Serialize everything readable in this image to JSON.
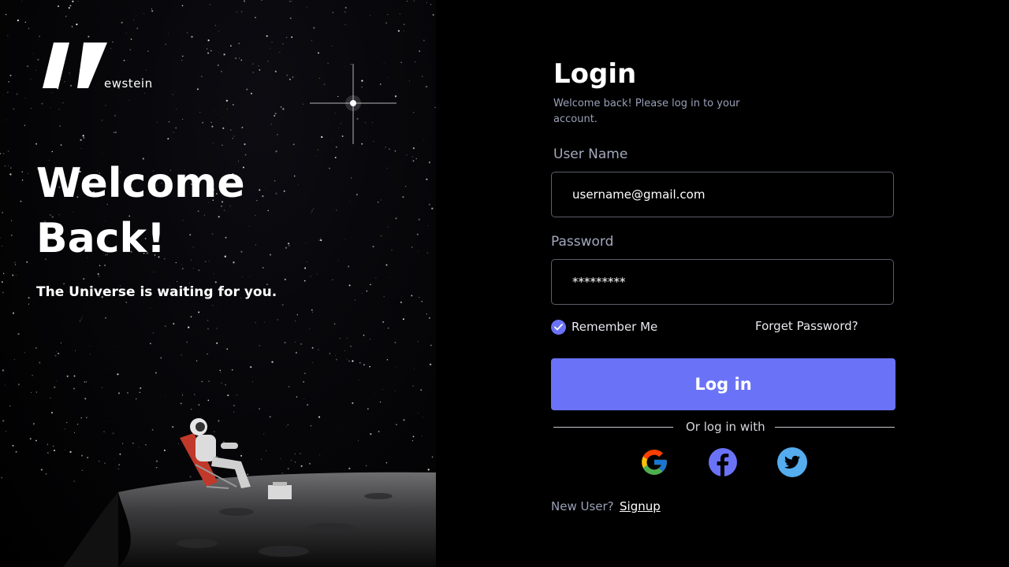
{
  "brand": {
    "logo_text": "ewstein"
  },
  "hero": {
    "title_line1": "Welcome",
    "title_line2": "Back!",
    "subtitle": "The Universe is waiting for you."
  },
  "form": {
    "title": "Login",
    "subtitle": "Welcome back! Please log in to your account.",
    "username_label": "User Name",
    "username_value": "username@gmail.com",
    "password_label": "Password",
    "password_value": "*********",
    "remember_label": "Remember Me",
    "remember_checked": true,
    "forgot_label": "Forget Password?",
    "login_label": "Log in",
    "divider_text": "Or log in with",
    "new_user_text": "New User?",
    "signup_label": "Signup"
  },
  "social": [
    {
      "icon": "google-icon"
    },
    {
      "icon": "facebook-icon",
      "color": "#6a73f8"
    },
    {
      "icon": "twitter-icon",
      "color": "#55acee"
    }
  ],
  "colors": {
    "accent": "#6a73f8",
    "background": "#000000",
    "muted_text": "#9aa0b6"
  }
}
